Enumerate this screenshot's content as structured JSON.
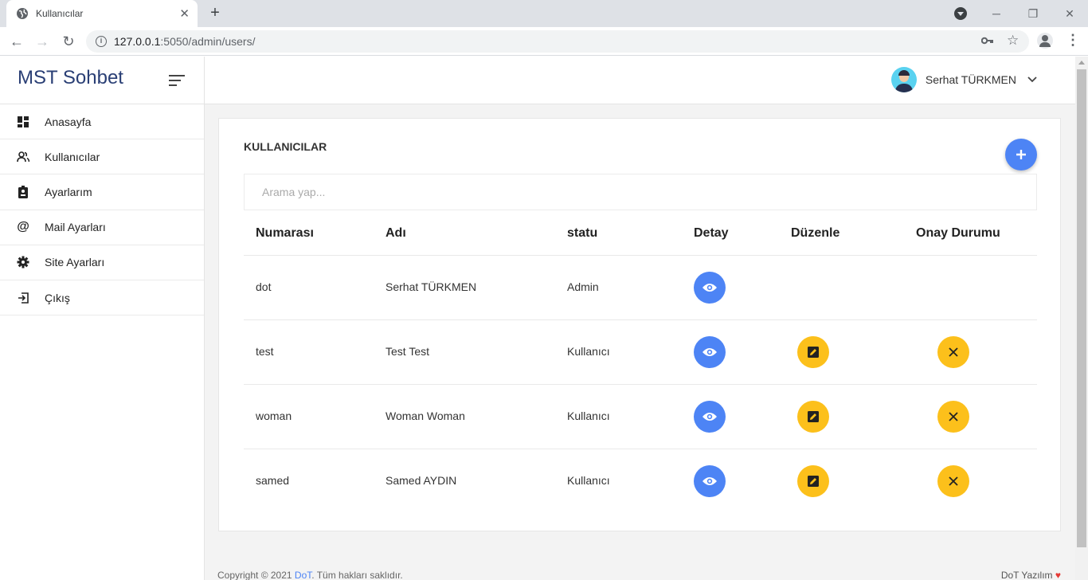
{
  "browser": {
    "tab_title": "Kullanıcılar",
    "url_host": "127.0.0.1",
    "url_rest": ":5050/admin/users/"
  },
  "app": {
    "brand": "MST Sohbet",
    "user_name": "Serhat TÜRKMEN"
  },
  "sidebar": {
    "items": [
      {
        "label": "Anasayfa",
        "icon": "dashboard-icon"
      },
      {
        "label": "Kullanıcılar",
        "icon": "users-icon"
      },
      {
        "label": "Ayarlarım",
        "icon": "badge-icon"
      },
      {
        "label": "Mail Ayarları",
        "icon": "at-icon"
      },
      {
        "label": "Site Ayarları",
        "icon": "gear-icon"
      },
      {
        "label": "Çıkış",
        "icon": "logout-icon"
      }
    ]
  },
  "main": {
    "card_title": "KULLANICILAR",
    "search_placeholder": "Arama yap...",
    "headers": {
      "number": "Numarası",
      "name": "Adı",
      "status": "statu",
      "detail": "Detay",
      "edit": "Düzenle",
      "approval": "Onay Durumu"
    },
    "rows": [
      {
        "number": "dot",
        "name": "Serhat TÜRKMEN",
        "status": "Admin",
        "editable": false
      },
      {
        "number": "test",
        "name": "Test Test",
        "status": "Kullanıcı",
        "editable": true
      },
      {
        "number": "woman",
        "name": "Woman Woman",
        "status": "Kullanıcı",
        "editable": true
      },
      {
        "number": "samed",
        "name": "Samed AYDIN",
        "status": "Kullanıcı",
        "editable": true
      }
    ]
  },
  "footer": {
    "copyright_prefix": "Copyright © 2021 ",
    "copyright_link": "DoT",
    "copyright_suffix": ". Tüm hakları saklıdır.",
    "made_by": "DoT Yazılım",
    "heart": "♥"
  },
  "colors": {
    "primary": "#4d84f5",
    "warning": "#fcc01b",
    "brand": "#2a3f75"
  }
}
